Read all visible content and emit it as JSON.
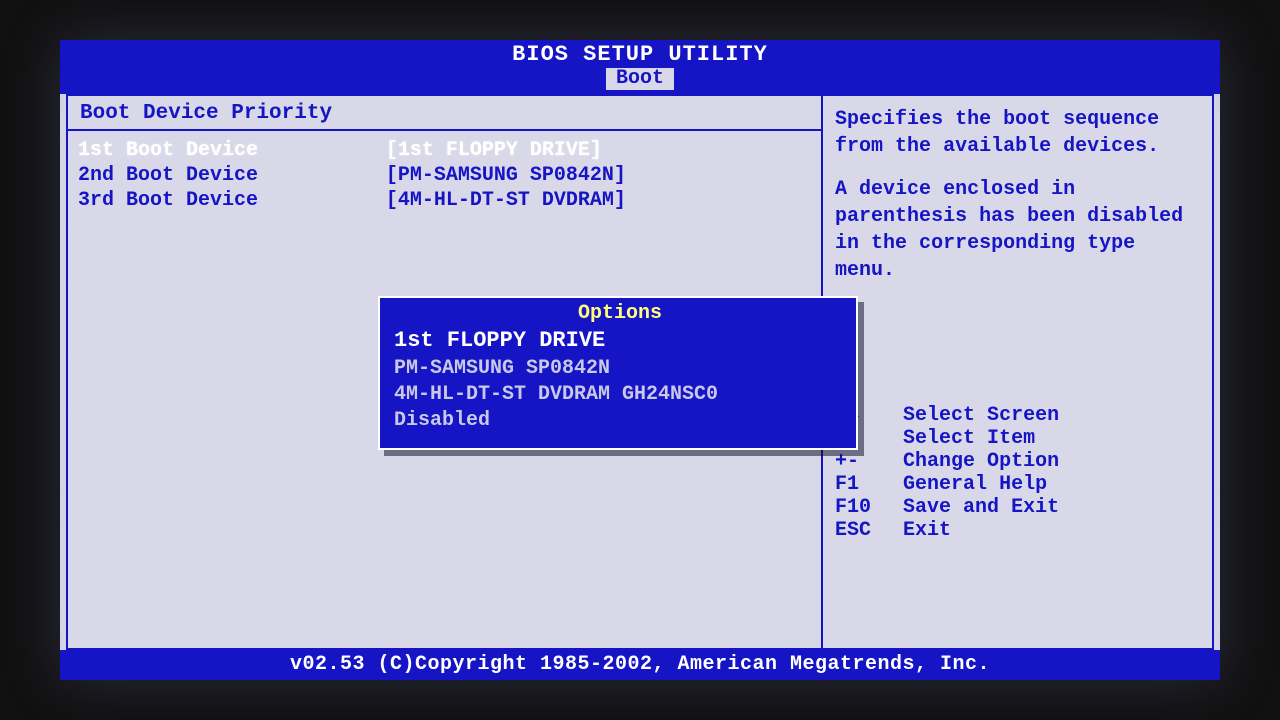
{
  "header": {
    "title": "BIOS SETUP UTILITY",
    "tab": "Boot"
  },
  "section": {
    "title": "Boot Device Priority"
  },
  "devices": [
    {
      "label": "1st Boot Device",
      "value": "[1st FLOPPY DRIVE]",
      "selected": true
    },
    {
      "label": "2nd Boot Device",
      "value": "[PM-SAMSUNG SP0842N]",
      "selected": false
    },
    {
      "label": "3rd Boot Device",
      "value": "[4M-HL-DT-ST DVDRAM]",
      "selected": false
    }
  ],
  "popup": {
    "title": "Options",
    "items": [
      {
        "text": "1st FLOPPY DRIVE",
        "selected": true
      },
      {
        "text": "PM-SAMSUNG SP0842N",
        "selected": false
      },
      {
        "text": "4M-HL-DT-ST DVDRAM GH24NSC0",
        "selected": false
      },
      {
        "text": "Disabled",
        "selected": false
      }
    ]
  },
  "help": {
    "p1": "Specifies the boot sequence from the available devices.",
    "p2": "A device enclosed in parenthesis has been disabled in the corresponding type menu."
  },
  "keys": [
    {
      "k": "←→",
      "d": "Select Screen"
    },
    {
      "k": "↑↓",
      "d": "Select Item"
    },
    {
      "k": "+-",
      "d": "Change Option"
    },
    {
      "k": "F1",
      "d": "General Help"
    },
    {
      "k": "F10",
      "d": "Save and Exit"
    },
    {
      "k": "ESC",
      "d": "Exit"
    }
  ],
  "footer": "v02.53 (C)Copyright 1985-2002, American Megatrends, Inc."
}
